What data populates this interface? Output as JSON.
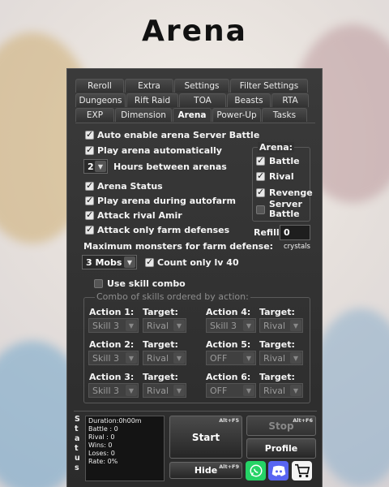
{
  "title": "Arena",
  "tabs": {
    "row1": [
      "Reroll",
      "Extra",
      "Settings",
      "Filter Settings"
    ],
    "row2": [
      "Dungeons",
      "Rift Raid",
      "TOA",
      "Beasts",
      "RTA"
    ],
    "row3": [
      "EXP",
      "Dimension",
      "Arena",
      "Power-Up",
      "Tasks"
    ],
    "active": "Arena"
  },
  "options": {
    "auto_enable": "Auto enable arena Server Battle",
    "play_auto": "Play arena automatically",
    "hours_value": "2",
    "hours_label": "Hours between arenas",
    "arena_status": "Arena Status",
    "play_during_autofarm": "Play arena during autofarm",
    "attack_rival": "Attack rival Amir",
    "attack_farm": "Attack only farm defenses",
    "max_monsters_label": "Maximum monsters for farm defense:",
    "mobs_value": "3 Mobs",
    "count_only": "Count only lv 40",
    "use_skill_combo": "Use skill combo"
  },
  "arena_group": {
    "title": "Arena:",
    "items": [
      "Battle",
      "Rival",
      "Revenge",
      "Server Battle"
    ]
  },
  "refill": {
    "label": "Refill",
    "value": "0",
    "unit": "crystals"
  },
  "combo": {
    "title": "Combo of skills ordered by action:",
    "target_label": "Target:",
    "actions": [
      {
        "label": "Action 1:",
        "skill": "Skill 3",
        "target": "Rival"
      },
      {
        "label": "Action 2:",
        "skill": "Skill 3",
        "target": "Rival"
      },
      {
        "label": "Action 3:",
        "skill": "Skill 3",
        "target": "Rival"
      },
      {
        "label": "Action 4:",
        "skill": "Skill 3",
        "target": "Rival"
      },
      {
        "label": "Action 5:",
        "skill": "OFF",
        "target": "Rival"
      },
      {
        "label": "Action 6:",
        "skill": "OFF",
        "target": "Rival"
      }
    ]
  },
  "status": {
    "vertical_letters": [
      "S",
      "t",
      "a",
      "t",
      "u",
      "s"
    ],
    "lines": [
      "Duration:0h00m",
      "Battle : 0",
      "Rival : 0",
      "Wins: 0",
      "Loses: 0",
      "Rate: 0%"
    ]
  },
  "buttons": {
    "start": "Start",
    "start_hotkey": "Alt+F5",
    "stop": "Stop",
    "stop_hotkey": "Alt+F6",
    "profile": "Profile",
    "hide": "Hide",
    "hide_hotkey": "Alt+F9"
  },
  "colors": {
    "panel": "#333333",
    "whatsapp": "#25d366",
    "discord": "#5865f2"
  },
  "icons": [
    "whatsapp-icon",
    "discord-icon",
    "cart-icon"
  ]
}
